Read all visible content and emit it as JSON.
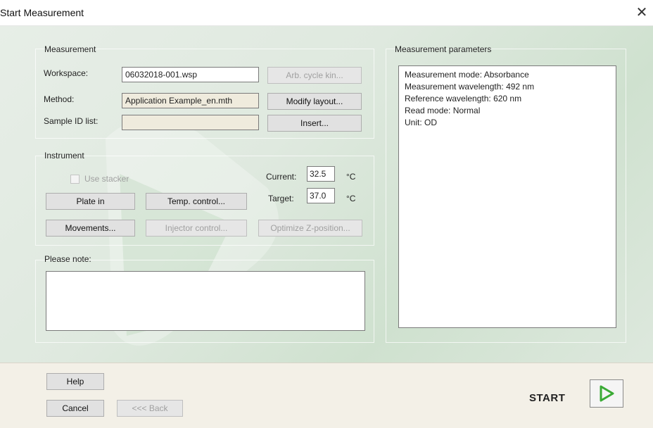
{
  "window": {
    "title": "Start Measurement",
    "close_glyph": "✕"
  },
  "measurement": {
    "group_label": "Measurement",
    "workspace_label": "Workspace:",
    "workspace_value": "06032018-001.wsp",
    "method_label": "Method:",
    "method_value": "Application Example_en.mth",
    "sample_id_label": "Sample ID list:",
    "sample_id_value": "",
    "arb_cycle_label": "Arb. cycle kin...",
    "modify_layout_label": "Modify layout...",
    "insert_label": "Insert..."
  },
  "instrument": {
    "group_label": "Instrument",
    "use_stacker_label": "Use stacker",
    "current_label": "Current:",
    "current_value": "32.5",
    "target_label": "Target:",
    "target_value": "37.0",
    "unit": "°C",
    "plate_in_label": "Plate in",
    "temp_control_label": "Temp. control...",
    "movements_label": "Movements...",
    "injector_control_label": "Injector control...",
    "optimize_z_label": "Optimize Z-position..."
  },
  "note": {
    "label": "Please note:",
    "value": ""
  },
  "parameters": {
    "group_label": "Measurement parameters",
    "lines": [
      "Measurement mode: Absorbance",
      "Measurement wavelength: 492 nm",
      "Reference wavelength: 620 nm",
      "Read mode: Normal",
      "Unit: OD"
    ]
  },
  "footer": {
    "help_label": "Help",
    "cancel_label": "Cancel",
    "back_label": "<<< Back",
    "start_label": "START",
    "start_icon": "play-icon",
    "start_icon_color": "#3aaa35"
  }
}
